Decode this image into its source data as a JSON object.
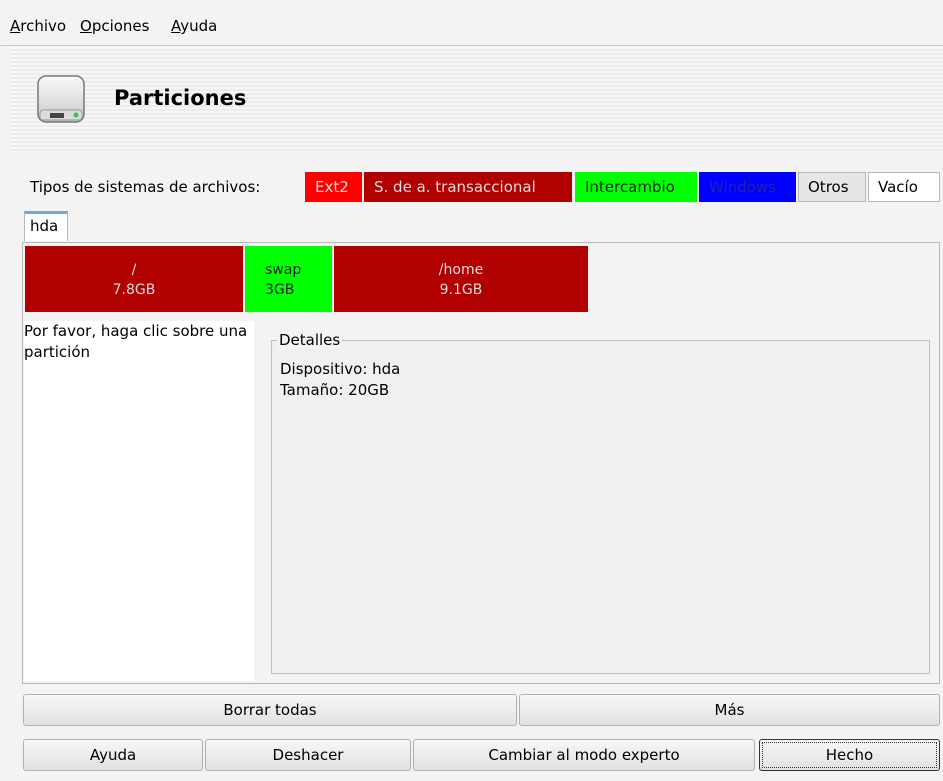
{
  "menu": [
    {
      "ul": "A",
      "rest": "rchivo"
    },
    {
      "ul": "O",
      "rest": "pciones"
    },
    {
      "ul": "A",
      "rest": "yuda"
    }
  ],
  "header": {
    "title": "Particiones",
    "icon": "hard-drive-icon"
  },
  "fs_types": {
    "label": "Tipos de sistemas de archivos:",
    "items": [
      {
        "label": "Ext2",
        "color": "#ff0000",
        "text_color": "#dddddd"
      },
      {
        "label": "S. de a. transaccional",
        "color": "#b10000",
        "text_color": "#dddddd"
      },
      {
        "label": "Intercambio",
        "color": "#00ff00",
        "text_color": "#222222"
      },
      {
        "label": "Windows",
        "color": "#0000ff",
        "text_color": "#2222aa"
      },
      {
        "label": "Otros",
        "color": "#e6e6e6",
        "text_color": "#000000"
      },
      {
        "label": "Vacío",
        "color": "#ffffff",
        "text_color": "#000000"
      }
    ]
  },
  "disk_tab": "hda",
  "partitions": [
    {
      "mount": "/",
      "size": "7.8GB",
      "color": "#b10000"
    },
    {
      "mount": "swap",
      "size": "3GB",
      "color": "#00ff00"
    },
    {
      "mount": "/home",
      "size": "9.1GB",
      "color": "#b10000"
    }
  ],
  "hint": "Por favor, haga clic sobre una partición",
  "details": {
    "title": "Detalles",
    "device": "Dispositivo: hda",
    "size": "Tamaño: 20GB"
  },
  "buttons": {
    "delete_all": "Borrar todas",
    "more": "Más",
    "help": "Ayuda",
    "undo": "Deshacer",
    "expert": "Cambiar al modo experto",
    "done": "Hecho"
  }
}
